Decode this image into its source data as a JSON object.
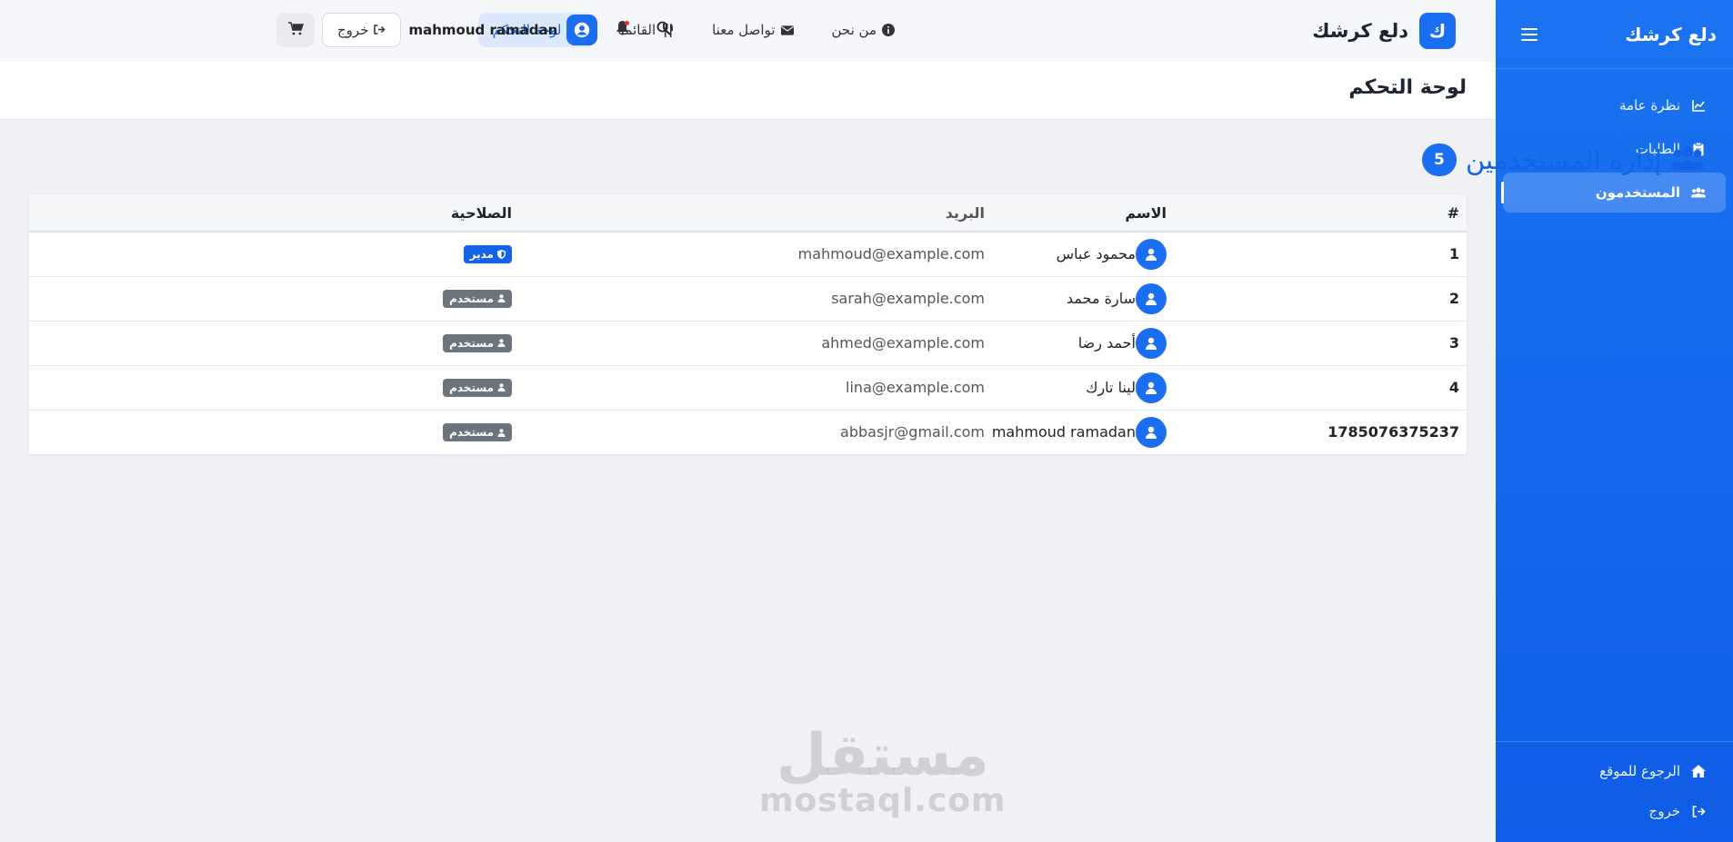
{
  "sidebar": {
    "brand": "دلع كرشك",
    "items": [
      {
        "label": "نظرة عامة",
        "icon": "chart-line-icon"
      },
      {
        "label": "الطلبات",
        "icon": "clipboard-icon"
      },
      {
        "label": "المستخدمون",
        "icon": "users-icon",
        "active": true
      }
    ],
    "bottom": [
      {
        "label": "الرجوع للموقع",
        "icon": "home-icon"
      },
      {
        "label": "خروج",
        "icon": "sign-out-icon"
      }
    ]
  },
  "topbar": {
    "logo_letter": "ك",
    "brand": "دلع كرشك",
    "nav": [
      {
        "label": "من نحن",
        "icon": "info-circle-icon"
      },
      {
        "label": "تواصل معنا",
        "icon": "envelope-icon"
      },
      {
        "label": "القائمة",
        "icon": "utensils-icon"
      },
      {
        "label": "لوحة التحكم",
        "icon": "gauge-icon",
        "active": true
      }
    ],
    "user_name": "mahmoud ramadan",
    "logout_label": "خروج"
  },
  "page": {
    "title": "لوحة التحكم",
    "section_title": "إدارة المستخدمين",
    "user_count": "5"
  },
  "table": {
    "headers": {
      "id": "#",
      "name": "الاسم",
      "email": "البريد",
      "role": "الصلاحية"
    },
    "rows": [
      {
        "id": "1",
        "name": "محمود عباس",
        "email": "mahmoud@example.com",
        "role": "مدير",
        "role_type": "admin"
      },
      {
        "id": "2",
        "name": "سارة محمد",
        "email": "sarah@example.com",
        "role": "مستخدم",
        "role_type": "user"
      },
      {
        "id": "3",
        "name": "أحمد رضا",
        "email": "ahmed@example.com",
        "role": "مستخدم",
        "role_type": "user"
      },
      {
        "id": "4",
        "name": "لينا تارك",
        "email": "lina@example.com",
        "role": "مستخدم",
        "role_type": "user"
      },
      {
        "id": "1785076375237",
        "name": "mahmoud ramadan",
        "email": "abbasjr@gmail.com",
        "role": "مستخدم",
        "role_type": "user"
      }
    ]
  },
  "watermark": {
    "arabic": "مستقل",
    "latin": "mostaql.com"
  },
  "colors": {
    "primary": "#1a6ef0",
    "admin_badge": "#1463e4",
    "user_badge": "#6c757d",
    "background": "#f0f1f4"
  }
}
